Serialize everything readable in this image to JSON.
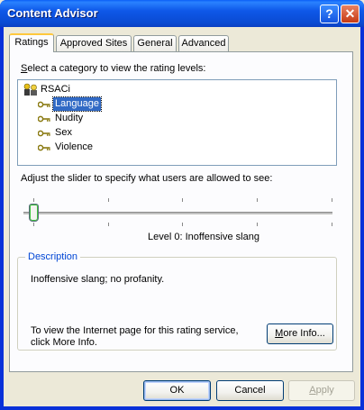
{
  "window": {
    "title": "Content Advisor",
    "help_label": "?",
    "close_label": "✕"
  },
  "tabs": [
    {
      "label": "Ratings",
      "active": true
    },
    {
      "label": "Approved Sites",
      "active": false
    },
    {
      "label": "General",
      "active": false
    },
    {
      "label": "Advanced",
      "active": false
    }
  ],
  "ratings": {
    "category_prompt": {
      "pre": "",
      "accel": "S",
      "post": "elect a category to view the rating levels:"
    },
    "tree": {
      "root": "RSACi",
      "items": [
        "Language",
        "Nudity",
        "Sex",
        "Violence"
      ],
      "selected": "Language"
    },
    "slider_prompt": {
      "pre": "Ad",
      "accel": "j",
      "post": "ust the slider to specify what users are allowed to see:"
    },
    "slider": {
      "level_fraction": 0,
      "tick_count": 5
    },
    "level_text": "Level 0:  Inoffensive slang",
    "description": {
      "legend": "Description",
      "text": "Inoffensive slang; no profanity.",
      "info_text_line1": "To view the Internet page for this rating service,",
      "info_text_line2": "click More Info.",
      "more_info": {
        "pre": "",
        "accel": "M",
        "post": "ore Info..."
      }
    }
  },
  "buttons": {
    "ok": "OK",
    "cancel": "Cancel",
    "apply": {
      "pre": "",
      "accel": "A",
      "post": "pply"
    }
  },
  "colors": {
    "title_bar": "#0a4ad2",
    "selection": "#316ac5",
    "description_legend": "#0046d5",
    "key_icon": "#8a7a12"
  },
  "icons": {
    "root": "people-icon",
    "category": "key-icon"
  }
}
